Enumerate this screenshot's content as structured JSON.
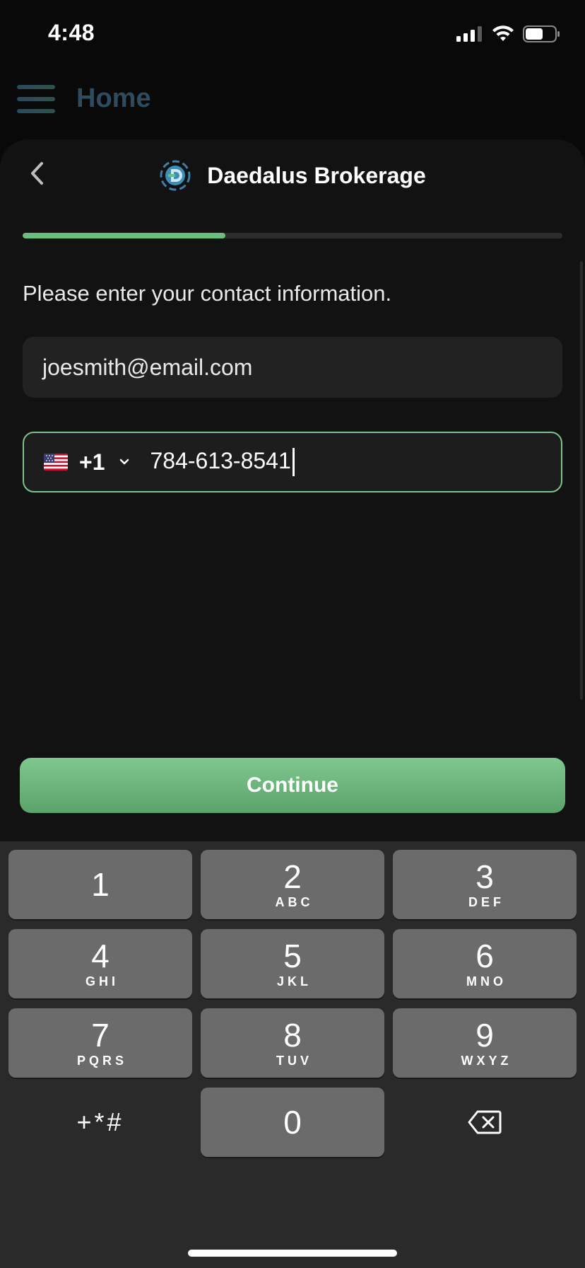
{
  "status_bar": {
    "time": "4:48",
    "icons": [
      "signal-icon",
      "wifi-icon",
      "battery-icon"
    ]
  },
  "background_app": {
    "title": "Home",
    "menu_icon": "hamburger-icon"
  },
  "sheet": {
    "back_icon": "chevron-left-icon",
    "brand_name": "Daedalus Brokerage",
    "logo_icon": "daedalus-logo-icon",
    "progress_fraction": 0.375,
    "prompt": "Please enter your contact information.",
    "email_value": "joesmith@email.com",
    "phone": {
      "country_flag": "us-flag-icon",
      "dial_code": "+1",
      "number": "784-613-8541"
    },
    "continue_label": "Continue"
  },
  "keypad": {
    "keys": [
      {
        "num": "1",
        "letters": ""
      },
      {
        "num": "2",
        "letters": "ABC"
      },
      {
        "num": "3",
        "letters": "DEF"
      },
      {
        "num": "4",
        "letters": "GHI"
      },
      {
        "num": "5",
        "letters": "JKL"
      },
      {
        "num": "6",
        "letters": "MNO"
      },
      {
        "num": "7",
        "letters": "PQRS"
      },
      {
        "num": "8",
        "letters": "TUV"
      },
      {
        "num": "9",
        "letters": "WXYZ"
      },
      {
        "num": "0",
        "letters": ""
      }
    ],
    "symbols_label": "+*#",
    "delete_icon": "backspace-icon"
  },
  "colors": {
    "accent": "#7dc48c",
    "sheet_bg": "#121212",
    "keypad_bg": "#2a2a2a",
    "key_bg": "#6b6b6b"
  }
}
